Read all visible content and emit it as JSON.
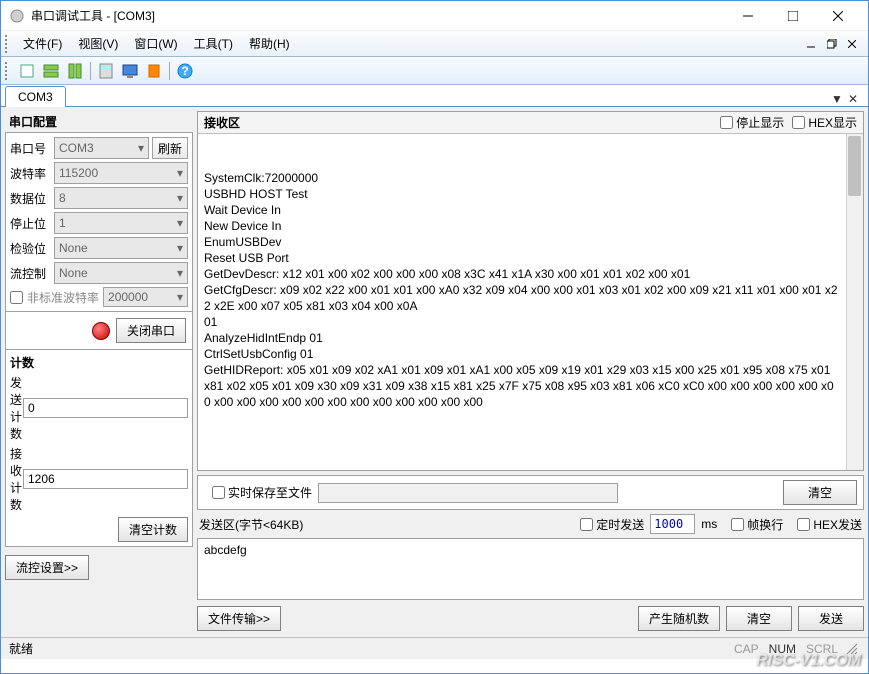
{
  "window": {
    "title": "串口调试工具 - [COM3]"
  },
  "menubar": {
    "file": "文件(F)",
    "view": "视图(V)",
    "window": "窗口(W)",
    "tools": "工具(T)",
    "help": "帮助(H)"
  },
  "tabs": {
    "active": "COM3"
  },
  "sidebar": {
    "config_title": "串口配置",
    "port_label": "串口号",
    "port_value": "COM3",
    "refresh": "刷新",
    "baud_label": "波特率",
    "baud_value": "115200",
    "databits_label": "数据位",
    "databits_value": "8",
    "stopbits_label": "停止位",
    "stopbits_value": "1",
    "parity_label": "检验位",
    "parity_value": "None",
    "flowctrl_label": "流控制",
    "flowctrl_value": "None",
    "nonstd_baud": "非标准波特率",
    "nonstd_baud_value": "200000",
    "close_port": "关闭串口",
    "count_title": "计数",
    "send_count_label": "发送计数",
    "send_count_value": "0",
    "recv_count_label": "接收计数",
    "recv_count_value": "1206",
    "clear_count": "清空计数",
    "flow_settings": "流控设置>>"
  },
  "recv": {
    "title": "接收区",
    "stop_display": "停止显示",
    "hex_display": "HEX显示",
    "text": "SystemClk:72000000\nUSBHD HOST Test\nWait Device In\nNew Device In\nEnumUSBDev\nReset USB Port\nGetDevDescr: x12 x01 x00 x02 x00 x00 x00 x08 x3C x41 x1A x30 x00 x01 x01 x02 x00 x01\nGetCfgDescr: x09 x02 x22 x00 x01 x01 x00 xA0 x32 x09 x04 x00 x00 x01 x03 x01 x02 x00 x09 x21 x11 x01 x00 x01 x22 x2E x00 x07 x05 x81 x03 x04 x00 x0A\n01\nAnalyzeHidIntEndp 01\nCtrlSetUsbConfig 01\nGetHIDReport: x05 x01 x09 x02 xA1 x01 x09 x01 xA1 x00 x05 x09 x19 x01 x29 x03 x15 x00 x25 x01 x95 x08 x75 x01 x81 x02 x05 x01 x09 x30 x09 x31 x09 x38 x15 x81 x25 x7F x75 x08 x95 x03 x81 x06 xC0 xC0 x00 x00 x00 x00 x00 x00 x00 x00 x00 x00 x00 x00 x00 x00 x00 x00 x00 x00"
  },
  "save": {
    "realtime_save": "实时保存至文件",
    "clear": "清空"
  },
  "send": {
    "title": "发送区(字节<64KB)",
    "timed_send": "定时发送",
    "interval": "1000",
    "ms": "ms",
    "frame_wrap": "帧换行",
    "hex_send": "HEX发送",
    "text": "abcdefg",
    "file_transfer": "文件传输>>",
    "random": "产生随机数",
    "clear": "清空",
    "send_btn": "发送"
  },
  "statusbar": {
    "ready": "就绪",
    "cap": "CAP",
    "num": "NUM",
    "scrl": "SCRL"
  },
  "watermark": "RISC-V1.COM"
}
